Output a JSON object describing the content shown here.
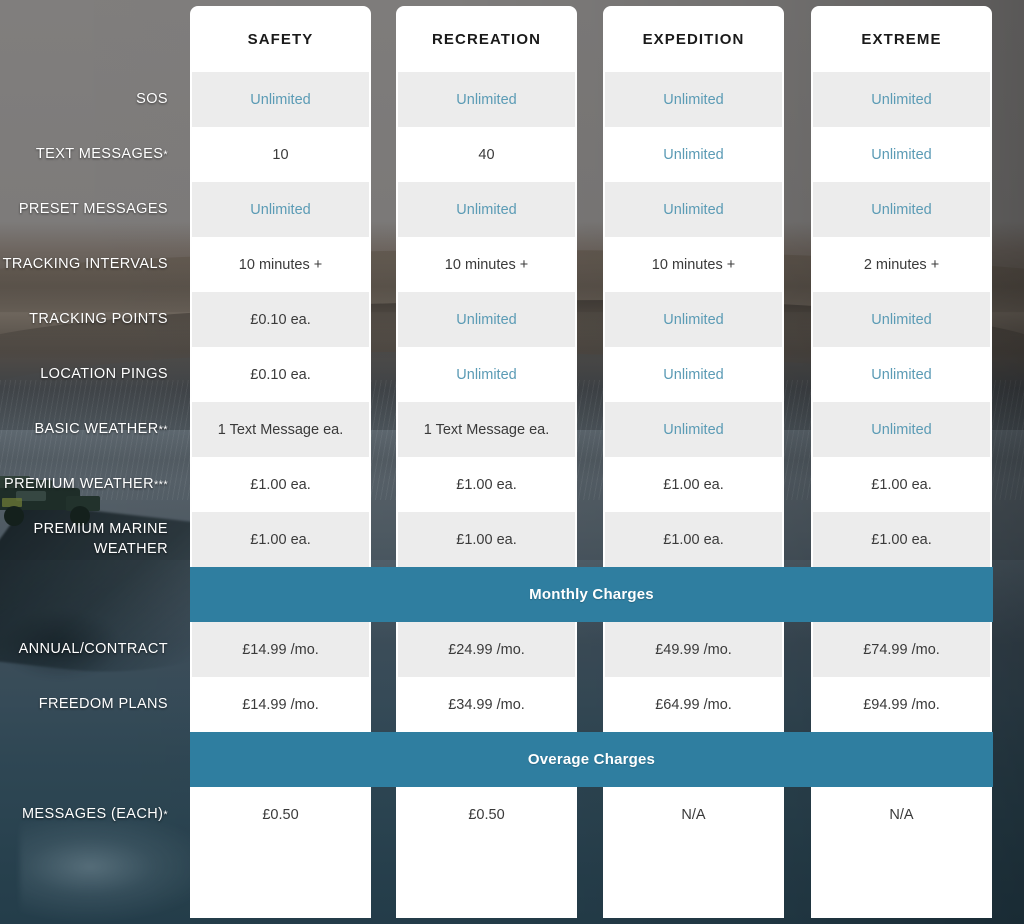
{
  "plans": [
    {
      "name": "SAFETY"
    },
    {
      "name": "RECREATION"
    },
    {
      "name": "EXPEDITION"
    },
    {
      "name": "EXTREME"
    }
  ],
  "colors": {
    "banner": "#2f7ea0",
    "unlimited_text": "#5b9bb5",
    "cell_shaded": "#ececec",
    "cell_plain": "#ffffff",
    "label_text": "#ffffff",
    "value_text": "#3a3a3a"
  },
  "feature_rows": [
    {
      "label": "SOS",
      "note": "",
      "shaded": true,
      "values": [
        "Unlimited",
        "Unlimited",
        "Unlimited",
        "Unlimited"
      ]
    },
    {
      "label": "TEXT MESSAGES",
      "note": "*",
      "shaded": false,
      "values": [
        "10",
        "40",
        "Unlimited",
        "Unlimited"
      ]
    },
    {
      "label": "PRESET MESSAGES",
      "note": "",
      "shaded": true,
      "values": [
        "Unlimited",
        "Unlimited",
        "Unlimited",
        "Unlimited"
      ]
    },
    {
      "label": "TRACKING INTERVALS",
      "note": "",
      "shaded": false,
      "values": [
        "10 minutes +",
        "10 minutes +",
        "10 minutes +",
        "2 minutes +"
      ]
    },
    {
      "label": "TRACKING POINTS",
      "note": "",
      "shaded": true,
      "values": [
        "£0.10 ea.",
        "Unlimited",
        "Unlimited",
        "Unlimited"
      ]
    },
    {
      "label": "LOCATION PINGS",
      "note": "",
      "shaded": false,
      "values": [
        "£0.10 ea.",
        "Unlimited",
        "Unlimited",
        "Unlimited"
      ]
    },
    {
      "label": "BASIC WEATHER",
      "note": "**",
      "shaded": true,
      "values": [
        "1 Text Message ea.",
        "1 Text Message ea.",
        "Unlimited",
        "Unlimited"
      ]
    },
    {
      "label": "PREMIUM WEATHER",
      "note": "***",
      "shaded": false,
      "values": [
        "£1.00 ea.",
        "£1.00 ea.",
        "£1.00 ea.",
        "£1.00 ea."
      ]
    },
    {
      "label": "PREMIUM MARINE WEATHER",
      "note": "",
      "shaded": true,
      "values": [
        "£1.00 ea.",
        "£1.00 ea.",
        "£1.00 ea.",
        "£1.00 ea."
      ]
    }
  ],
  "monthly_banner": {
    "label": "Monthly Charges"
  },
  "monthly_rows": [
    {
      "label": "ANNUAL/CONTRACT",
      "note": "",
      "shaded": true,
      "values": [
        "£14.99 /mo.",
        "£24.99 /mo.",
        "£49.99 /mo.",
        "£74.99 /mo."
      ]
    },
    {
      "label": "FREEDOM PLANS",
      "note": "",
      "shaded": false,
      "values": [
        "£14.99 /mo.",
        "£34.99 /mo.",
        "£64.99 /mo.",
        "£94.99 /mo."
      ]
    }
  ],
  "overage_banner": {
    "label": "Overage Charges"
  },
  "overage_rows": [
    {
      "label": "MESSAGES (EACH)",
      "note": "*",
      "shaded": false,
      "values": [
        "£0.50",
        "£0.50",
        "N/A",
        "N/A"
      ]
    }
  ]
}
